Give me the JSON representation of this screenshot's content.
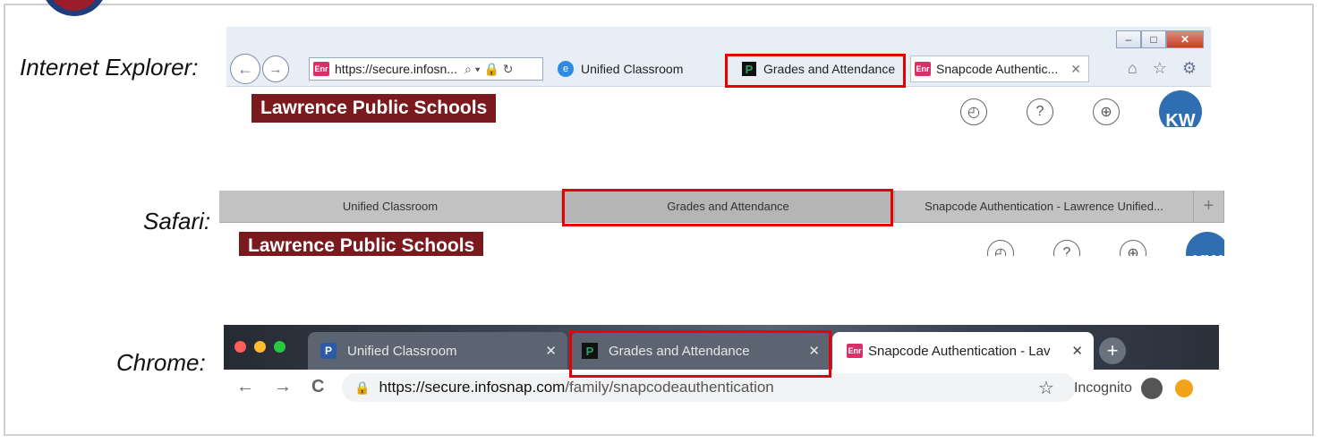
{
  "labels": {
    "ie": "Internet Explorer:",
    "safari": "Safari:",
    "chrome": "Chrome:"
  },
  "ie": {
    "window_buttons": {
      "minimize": "–",
      "maximize": "□",
      "close": "✕"
    },
    "nav": {
      "back": "←",
      "forward": "→"
    },
    "address": {
      "favicon": "Enr",
      "url": "https://secure.infosn...",
      "controls": "⌕ ▾ 🔒 ↻"
    },
    "tabs": [
      {
        "favicon": "e",
        "label": "Unified Classroom"
      },
      {
        "favicon": "P",
        "label": "Grades and Attendance"
      },
      {
        "favicon": "Enr",
        "label": "Snapcode Authentic...",
        "close": "✕"
      }
    ],
    "tools": "⌂ ☆ ⚙",
    "content": {
      "brand": "Lawrence Public Schools",
      "avatar": "KW"
    }
  },
  "safari": {
    "tabs": [
      {
        "label": "Unified Classroom"
      },
      {
        "label": "Grades and Attendance"
      },
      {
        "label": "Snapcode Authentication - Lawrence Unified..."
      }
    ],
    "new_tab": "+",
    "content": {
      "brand": "Lawrence Public Schools",
      "avatar": "KW"
    }
  },
  "chrome": {
    "traffic_colors": [
      "#ff5f57",
      "#febc2e",
      "#28c840"
    ],
    "tabs": [
      {
        "favicon": "P",
        "label": "Unified Classroom",
        "close": "✕"
      },
      {
        "favicon": "P",
        "label": "Grades and Attendance",
        "close": "✕"
      },
      {
        "favicon": "Enr",
        "label": "Snapcode Authentication - Lav",
        "close": "✕"
      }
    ],
    "new_tab": "+",
    "nav": {
      "back": "←",
      "forward": "→",
      "reload": "C"
    },
    "omnibox": {
      "url_host": "https://secure.infosnap.com",
      "url_path": "/family/snapcodeauthentication"
    },
    "star": "☆",
    "incognito": "Incognito",
    "icons": {
      "incognito": "incognito-icon",
      "extension": "extension-icon"
    }
  },
  "highlight_color": "#e60000"
}
